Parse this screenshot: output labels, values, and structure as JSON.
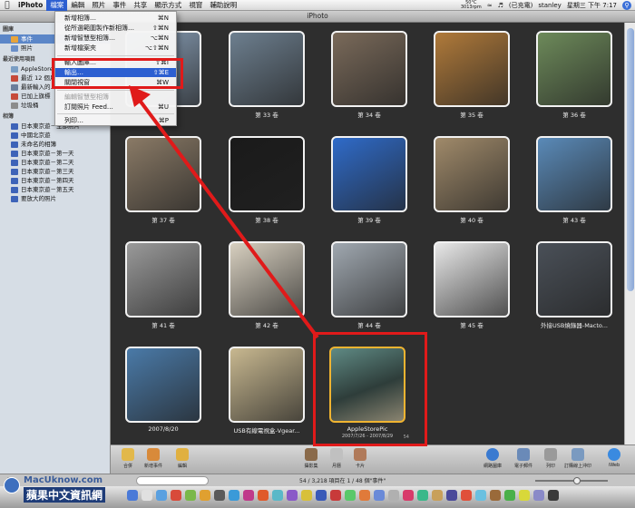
{
  "menubar": {
    "app": "iPhoto",
    "items": [
      "檔案",
      "編輯",
      "照片",
      "事件",
      "共享",
      "顯示方式",
      "視窗",
      "輔助說明"
    ],
    "temp": "50°C",
    "rpm": "3013rpm",
    "battery": "(已充電)",
    "user": "stanley",
    "clock": "星期三 下午 7:17"
  },
  "window": {
    "title": "iPhoto"
  },
  "sidebar": {
    "library_head": "圖庫",
    "library": [
      {
        "label": "事件",
        "icon": "events-icon",
        "selected": true
      },
      {
        "label": "照片",
        "icon": "photos-icon"
      }
    ],
    "recent_head": "最近使用項目",
    "recent": [
      {
        "label": "AppleStore",
        "icon": "event-icon"
      },
      {
        "label": "最近 12 個月",
        "icon": "calendar-icon"
      },
      {
        "label": "最新輸入的...",
        "icon": "film-roll-icon"
      },
      {
        "label": "已加上旗標",
        "icon": "flag-icon"
      },
      {
        "label": "垃圾桶",
        "icon": "trash-icon"
      }
    ],
    "albums_head": "相簿",
    "albums": [
      "日本東京遊－全部照片",
      "中國北京遊",
      "未命名的相簿",
      "日本東京遊－第一天",
      "日本東京遊－第二天",
      "日本東京遊－第三天",
      "日本東京遊－第四天",
      "日本東京遊－第五天",
      "要放大的照片"
    ]
  },
  "file_menu": {
    "items": [
      {
        "label": "新增相簿…",
        "shortcut": "⌘N"
      },
      {
        "label": "從所選範圍製作新相簿…",
        "shortcut": "⇧⌘N"
      },
      {
        "label": "新增智慧型相簿…",
        "shortcut": "⌥⌘N"
      },
      {
        "label": "新增檔案夾",
        "shortcut": "⌥⇧⌘N"
      },
      {
        "label": "輸入圖庫…",
        "shortcut": "⇧⌘I"
      },
      {
        "label": "輸出…",
        "shortcut": "⇧⌘E",
        "highlighted": true
      },
      {
        "label": "關閉視窗",
        "shortcut": "⌘W"
      },
      {
        "label": "編輯智慧型相簿",
        "shortcut": "",
        "disabled": true
      },
      {
        "label": "訂閱照片 Feed…",
        "shortcut": "⌘U"
      },
      {
        "label": "列印…",
        "shortcut": "⌘P"
      }
    ]
  },
  "events": [
    {
      "label": "",
      "tone": "#8aa0b8"
    },
    {
      "label": "第 33 卷",
      "tone": "#6d7f8f"
    },
    {
      "label": "第 34 卷",
      "tone": "#7a6a5a"
    },
    {
      "label": "第 35 卷",
      "tone": "#b07a3a"
    },
    {
      "label": "第 36 卷",
      "tone": "#6d8a5a"
    },
    {
      "label": "第 37 卷",
      "tone": "#8a7a66"
    },
    {
      "label": "第 38 卷",
      "tone": "#1a1a1a"
    },
    {
      "label": "第 39 卷",
      "tone": "#2f6bc9"
    },
    {
      "label": "第 40 卷",
      "tone": "#a08a6a"
    },
    {
      "label": "第 43 卷",
      "tone": "#5a8ab8"
    },
    {
      "label": "第 41 卷",
      "tone": "#9a9a9a"
    },
    {
      "label": "第 42 卷",
      "tone": "#d8d0c0"
    },
    {
      "label": "第 44 卷",
      "tone": "#a0a8b0"
    },
    {
      "label": "第 45 卷",
      "tone": "#e8e8e8"
    },
    {
      "label": "外接USB燒錄器-Macto...",
      "tone": "#4a5058"
    },
    {
      "label": "2007/8/20",
      "tone": "#4a7aa8"
    },
    {
      "label": "USB有線電視盒-Vgear...",
      "tone": "#c8b890"
    }
  ],
  "featured_event": {
    "label": "AppleStorePic",
    "date": "2007/7/26 - 2007/8/29",
    "count": "54"
  },
  "toolbar": {
    "buttons": [
      "合併",
      "新增事件",
      "編輯",
      "攝影集",
      "月曆",
      "卡片",
      "網路圖庫",
      "電子郵件",
      "列印",
      "訂購線上沖印",
      "iWeb"
    ]
  },
  "status": {
    "count_text": "54 / 3,218 項目在 1 / 48 個\"事件\""
  },
  "watermark": {
    "line1": "MacUknow.com",
    "line2": "蘋果中文資訊網"
  },
  "colors": {
    "highlight_red": "#e01a1a",
    "menu_blue": "#2c5fd1",
    "selected_event_border": "#f0b431"
  }
}
